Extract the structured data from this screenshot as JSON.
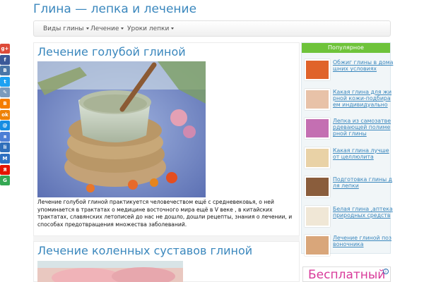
{
  "site": {
    "title": "Глина — лепка и лечение"
  },
  "nav": {
    "items": [
      {
        "label": "Виды глины"
      },
      {
        "label": "Лечение"
      },
      {
        "label": "Уроки лепки"
      }
    ]
  },
  "share": {
    "items": [
      {
        "icon": "google-plus-icon",
        "glyph": "g+",
        "color": "#dd4b39"
      },
      {
        "icon": "facebook-icon",
        "glyph": "f",
        "color": "#3b5998"
      },
      {
        "icon": "vk-icon",
        "glyph": "B",
        "color": "#4a76a8"
      },
      {
        "icon": "twitter-icon",
        "glyph": "t",
        "color": "#1da1f2"
      },
      {
        "icon": "livejournal-icon",
        "glyph": "✎",
        "color": "#7b9bbd"
      },
      {
        "icon": "blogger-icon",
        "glyph": "B",
        "color": "#f57d00"
      },
      {
        "icon": "odnoklassniki-icon",
        "glyph": "ok",
        "color": "#ee8208"
      },
      {
        "icon": "mail-ru-icon",
        "glyph": "@",
        "color": "#168de2"
      },
      {
        "icon": "ya-ru-icon",
        "glyph": "я",
        "color": "#4d7fd6"
      },
      {
        "icon": "liveinternet-icon",
        "glyph": "li",
        "color": "#2f6fbb"
      },
      {
        "icon": "moy-mir-icon",
        "glyph": "M",
        "color": "#2e70c2"
      },
      {
        "icon": "yandex-icon",
        "glyph": "Я",
        "color": "#e61400"
      },
      {
        "icon": "google-bookmarks-icon",
        "glyph": "G",
        "color": "#34a853"
      }
    ]
  },
  "articles": [
    {
      "title": "Лечение голубой глиной",
      "text": "Лечение голубой глиной практикуется человечеством ещё с средневековья, о ней упоминается в трактатах о медицине восточного мира ещё в V веке , в китайских трактатах, славянских летописей до нас не дошло, дошли рецепты, знания о лечении, и способах предотвращения множества заболеваний."
    },
    {
      "title": "Лечение коленных суставов глиной"
    }
  ],
  "sidebar": {
    "header": "Популярное",
    "items": [
      {
        "label": "Обжиг глины в домашних условиях",
        "thumb": "#e0632a"
      },
      {
        "label": "Какая глина для жирной кожи-подбираем индивидуально",
        "thumb": "#e8c2a8"
      },
      {
        "label": "Лепка из самозатвердевающей полимерной глины",
        "thumb": "#c46fb2"
      },
      {
        "label": "Какая глина лучше от целлюлита",
        "thumb": "#e9d2a6"
      },
      {
        "label": "Подготовка глины для лепки",
        "thumb": "#8a5d3c"
      },
      {
        "label": "Белая глина ,аптека природных средств",
        "thumb": "#f0e7d6"
      },
      {
        "label": "Лечение глиной позвоночника",
        "thumb": "#d9a67a"
      }
    ]
  },
  "ad": {
    "text": "Бесплатный",
    "mark": "i"
  }
}
